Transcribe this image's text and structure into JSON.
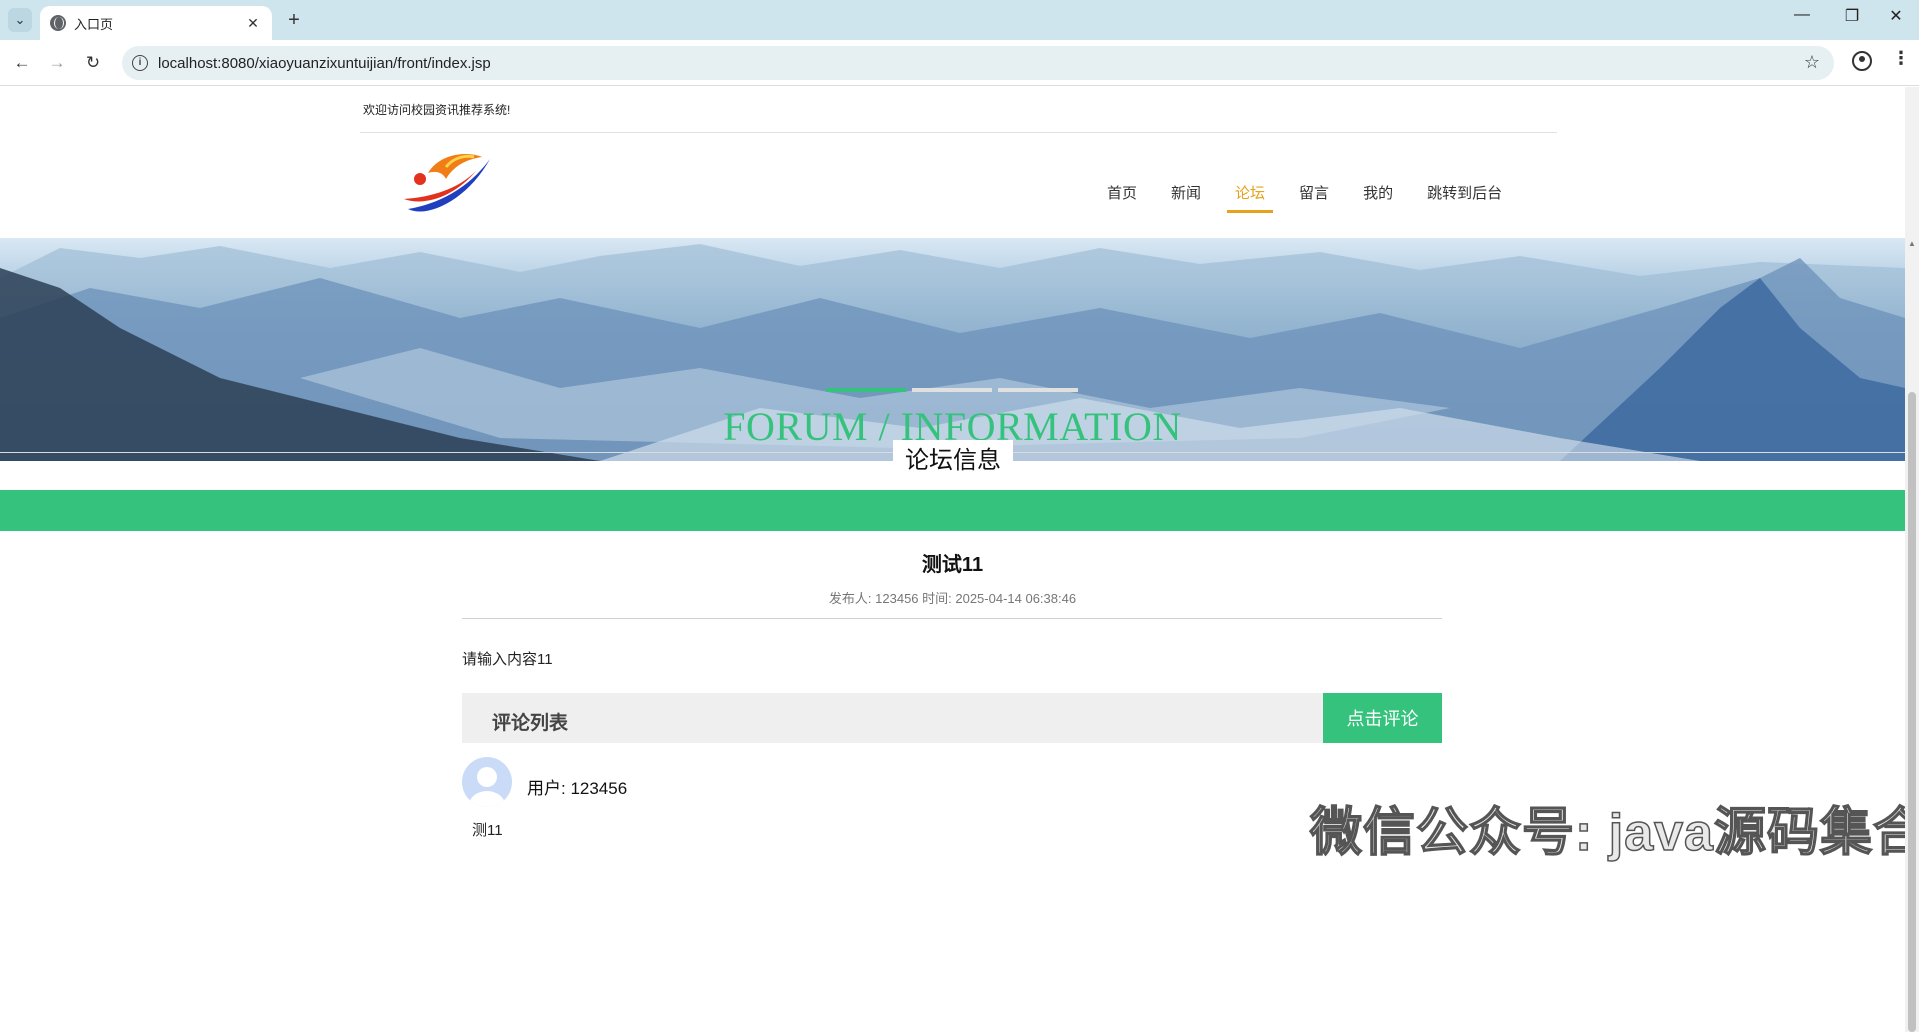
{
  "browser": {
    "tab_title": "入口页",
    "tab_close": "✕",
    "new_tab": "+",
    "url": "localhost:8080/xiaoyuanzixuntuijian/front/index.jsp",
    "window_controls": {
      "minimize": "—",
      "maximize": "❐",
      "close": "✕"
    }
  },
  "header": {
    "welcome": "欢迎访问校园资讯推荐系统!",
    "nav": [
      "首页",
      "新闻",
      "论坛",
      "留言",
      "我的",
      "跳转到后台"
    ],
    "active_nav": "论坛"
  },
  "section": {
    "title_en": "FORUM / INFORMATION",
    "title_zh": "论坛信息"
  },
  "article": {
    "title": "测试11",
    "meta": "发布人: 123456 时间: 2025-04-14 06:38:46",
    "content": "请输入内容11"
  },
  "comments": {
    "header_label": "评论列表",
    "add_button": "点击评论",
    "items": [
      {
        "user": "用户: 123456",
        "text": "测11"
      }
    ]
  },
  "watermark": "微信公众号: java源码集合",
  "colors": {
    "accent_green": "#35c27c",
    "nav_active": "#e8a11b",
    "tab_bar": "#cfe5ee"
  }
}
